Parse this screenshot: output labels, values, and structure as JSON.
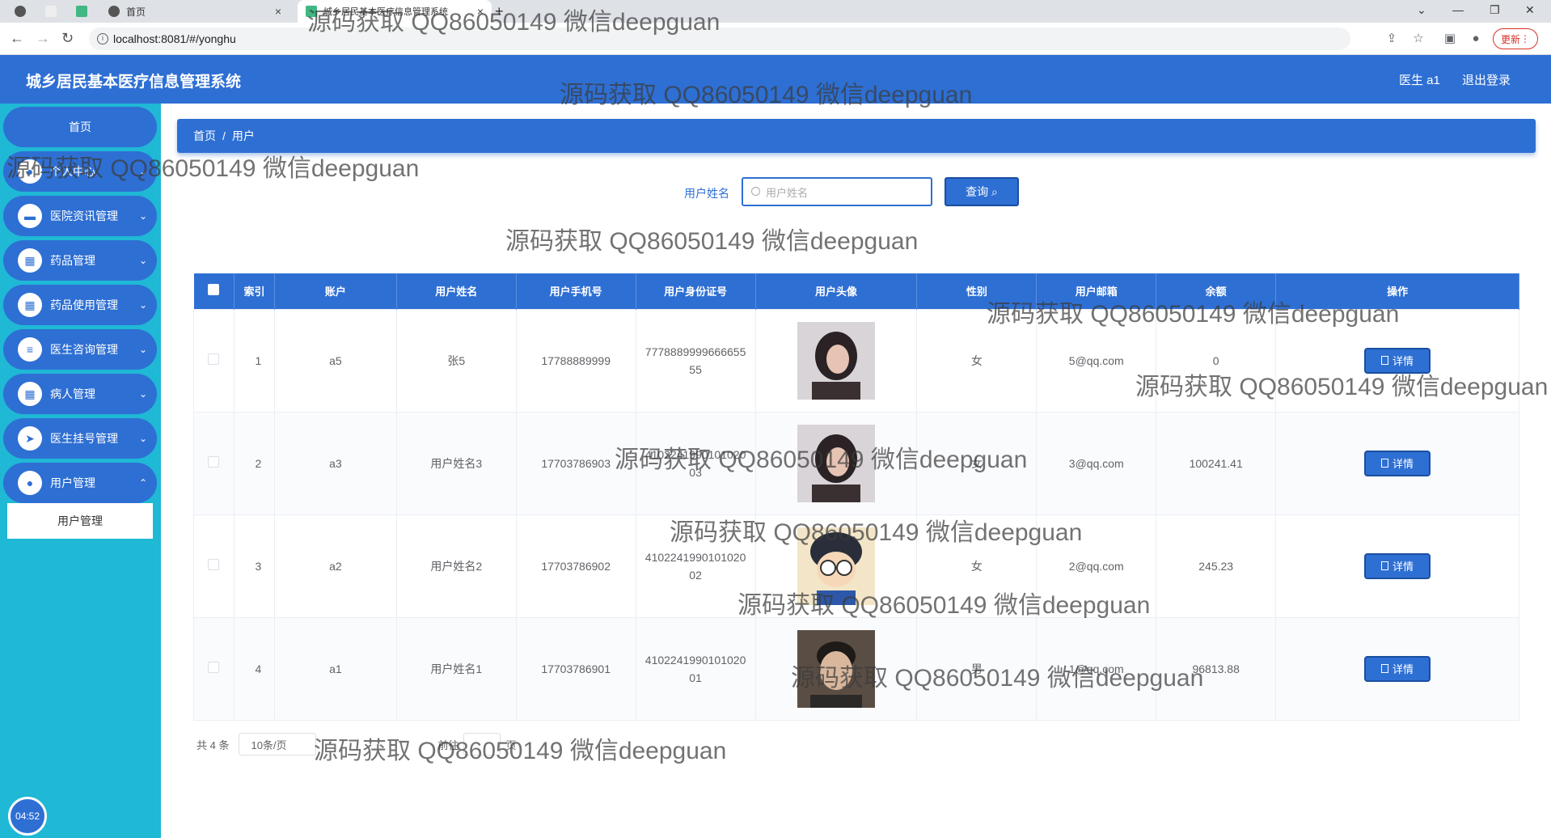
{
  "browser": {
    "tabs": [
      {
        "title": ""
      },
      {
        "title": ""
      },
      {
        "title": ""
      },
      {
        "title": "首页"
      },
      {
        "title": "城乡居民基本医疗信息管理系统"
      }
    ],
    "url": "localhost:8081/#/yonghu",
    "update_label": "更新"
  },
  "header": {
    "title": "城乡居民基本医疗信息管理系统",
    "user": "医生 a1",
    "logout": "退出登录"
  },
  "sidebar": {
    "home": "首页",
    "items": [
      {
        "label": "个人中心",
        "icon": "person-icon"
      },
      {
        "label": "医院资讯管理",
        "icon": "briefcase-icon"
      },
      {
        "label": "药品管理",
        "icon": "grid-icon"
      },
      {
        "label": "药品使用管理",
        "icon": "grid-icon"
      },
      {
        "label": "医生咨询管理",
        "icon": "list-icon"
      },
      {
        "label": "病人管理",
        "icon": "grid-icon"
      },
      {
        "label": "医生挂号管理",
        "icon": "send-icon"
      },
      {
        "label": "用户管理",
        "icon": "location-icon"
      }
    ],
    "submenu_item": "用户管理",
    "clock": "04:52"
  },
  "breadcrumb": {
    "home": "首页",
    "separator": "/",
    "current": "用户"
  },
  "search": {
    "label": "用户姓名",
    "placeholder": "用户姓名",
    "button": "查询"
  },
  "table": {
    "columns": [
      "索引",
      "账户",
      "用户姓名",
      "用户手机号",
      "用户身份证号",
      "用户头像",
      "性别",
      "用户邮箱",
      "余额",
      "操作"
    ],
    "rows": [
      {
        "index": "1",
        "account": "a5",
        "name": "张5",
        "phone": "17788889999",
        "id_card": "777888999966665555",
        "gender": "女",
        "email": "5@qq.com",
        "balance": "0",
        "avatar": "portrait-woman"
      },
      {
        "index": "2",
        "account": "a3",
        "name": "用户姓名3",
        "phone": "17703786903",
        "id_card": "410224199010102003",
        "gender": "女",
        "email": "3@qq.com",
        "balance": "100241.41",
        "avatar": "portrait-woman"
      },
      {
        "index": "3",
        "account": "a2",
        "name": "用户姓名2",
        "phone": "17703786902",
        "id_card": "410224199010102002",
        "gender": "女",
        "email": "2@qq.com",
        "balance": "245.23",
        "avatar": "cartoon-boy"
      },
      {
        "index": "4",
        "account": "a1",
        "name": "用户姓名1",
        "phone": "17703786901",
        "id_card": "410224199010102001",
        "gender": "男",
        "email": "1@qq.com",
        "balance": "96813.88",
        "avatar": "portrait-man"
      }
    ],
    "action_label": "详情"
  },
  "pagination": {
    "total": "共 4 条",
    "page_size": "10条/页",
    "goto_prefix": "前往",
    "goto_suffix": "页"
  },
  "watermark": "源码获取 QQ86050149 微信deepguan",
  "colors": {
    "primary": "#2e6fd3",
    "sidebar": "#1fb8d5"
  }
}
